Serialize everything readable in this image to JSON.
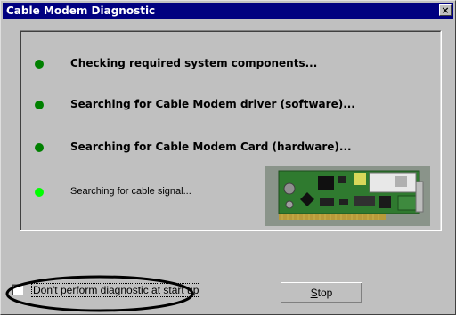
{
  "window": {
    "title": "Cable Modem Diagnostic",
    "close_label": "×"
  },
  "steps": [
    {
      "label": "Checking required system components...",
      "status_color": "#008000",
      "emphasis": "bold"
    },
    {
      "label": "Searching for Cable Modem driver (software)...",
      "status_color": "#008000",
      "emphasis": "bold"
    },
    {
      "label": "Searching for Cable Modem Card (hardware)...",
      "status_color": "#008000",
      "emphasis": "bold"
    },
    {
      "label": "Searching for cable signal...",
      "status_color": "#00ff00",
      "emphasis": "normal"
    }
  ],
  "image": {
    "icon": "cable-modem-card-image"
  },
  "options": {
    "skip_diagnostic_label": "Don't perform diagnostic at start up",
    "skip_diagnostic_checked": false
  },
  "buttons": {
    "stop_label": "Stop"
  },
  "colors": {
    "titlebar": "#000080",
    "face": "#c0c0c0",
    "done": "#008000",
    "active": "#00ff00"
  }
}
